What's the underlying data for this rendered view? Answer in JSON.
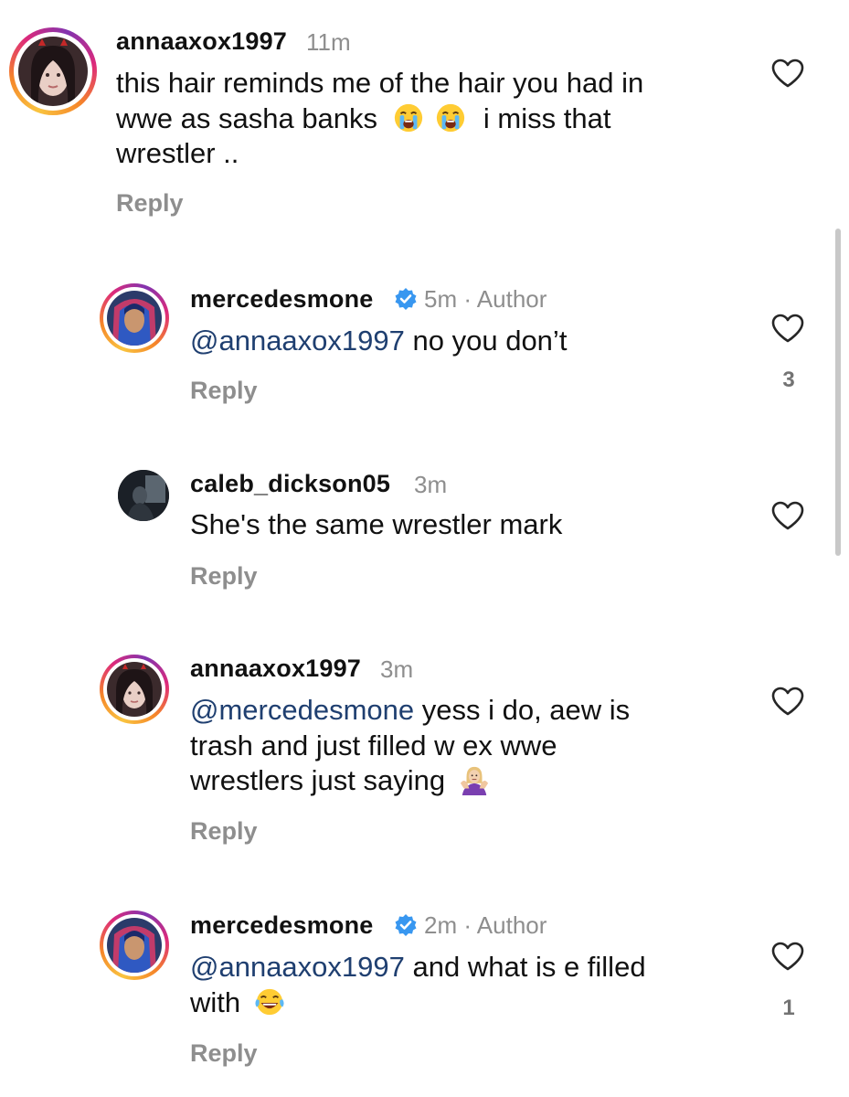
{
  "comments": [
    {
      "username": "annaaxox1997",
      "time": "11m",
      "author_tag": "",
      "lines": [
        "this hair reminds me of the hair you had in",
        "wwe as sasha banks",
        "i miss that",
        "wrestler .."
      ],
      "reply_label": "Reply",
      "likes": "",
      "emoji": [
        "loudly-crying-face",
        "loudly-crying-face"
      ]
    },
    {
      "username": "mercedesmone",
      "time": "5m",
      "author_tag": "· Author",
      "mention": "@annaaxox1997",
      "lines": [
        "no you don’t"
      ],
      "reply_label": "Reply",
      "likes": "3",
      "verified": true
    },
    {
      "username": "caleb_dickson05",
      "time": "3m",
      "author_tag": "",
      "lines": [
        "She's the same wrestler mark"
      ],
      "reply_label": "Reply",
      "likes": ""
    },
    {
      "username": "annaaxox1997",
      "time": "3m",
      "author_tag": "",
      "mention": "@mercedesmone",
      "lines": [
        "yess i do, aew is",
        "trash and just filled w ex wwe",
        "wrestlers just saying"
      ],
      "reply_label": "Reply",
      "likes": "",
      "emoji": [
        "woman-shrugging"
      ]
    },
    {
      "username": "mercedesmone",
      "time": "2m",
      "author_tag": "· Author",
      "mention": "@annaaxox1997",
      "lines": [
        "and what is e filled",
        "with"
      ],
      "reply_label": "Reply",
      "likes": "1",
      "verified": true,
      "emoji": [
        "face-with-tears-of-joy"
      ]
    }
  ],
  "colors": {
    "mention": "#1f3f70",
    "meta": "#8e8e8e",
    "verified": "#3897f0"
  }
}
